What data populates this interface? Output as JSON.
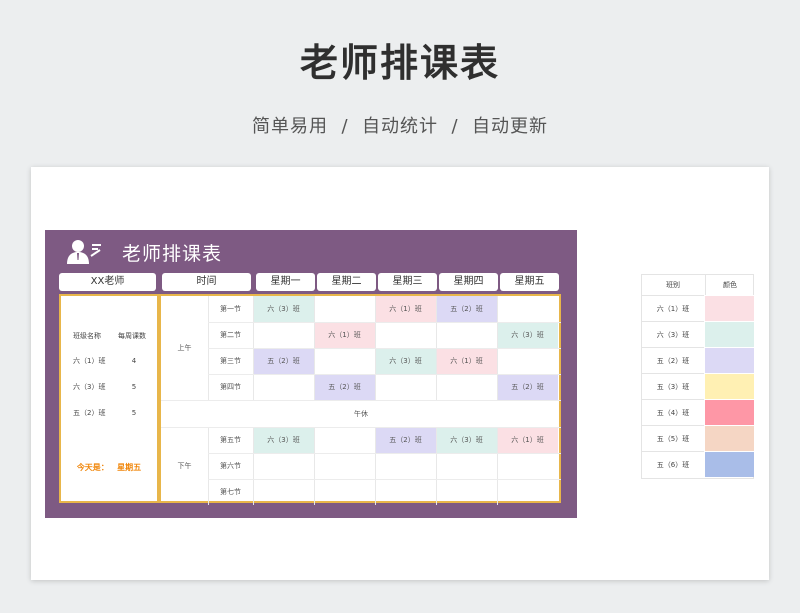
{
  "hero": {
    "title": "老师排课表",
    "subtitle": "简单易用  /  自动统计  /  自动更新"
  },
  "panel": {
    "title": "老师排课表",
    "icon": "teacher-icon",
    "bg_color": "#7e5a83"
  },
  "headers": {
    "teacher": "XX老师",
    "time": "时间",
    "days": [
      "星期一",
      "星期二",
      "星期三",
      "星期四",
      "星期五"
    ]
  },
  "teacher_panel": {
    "col_class": "班级名称",
    "col_count": "每周课数",
    "rows": [
      {
        "class": "六（1）班",
        "count": "4"
      },
      {
        "class": "六（3）班",
        "count": "5"
      },
      {
        "class": "五（2）班",
        "count": "5"
      }
    ],
    "today_label": "今天是：",
    "today_value": "星期五"
  },
  "schedule": {
    "morning_label": "上午",
    "afternoon_label": "下午",
    "lunch_label": "午休",
    "periods": [
      "第一节",
      "第二节",
      "第三节",
      "第四节",
      "第五节",
      "第六节",
      "第七节"
    ],
    "cells": [
      [
        "六（3）班",
        "",
        "六（1）班",
        "五（2）班",
        ""
      ],
      [
        "",
        "六（1）班",
        "",
        "",
        "六（3）班"
      ],
      [
        "五（2）班",
        "",
        "六（3）班",
        "六（1）班",
        ""
      ],
      [
        "",
        "五（2）班",
        "",
        "",
        "五（2）班"
      ],
      [
        "六（3）班",
        "",
        "五（2）班",
        "六（3）班",
        "六（1）班"
      ],
      [
        "",
        "",
        "",
        "",
        ""
      ],
      [
        "",
        "",
        "",
        "",
        ""
      ]
    ]
  },
  "legend": {
    "col_class": "班别",
    "col_color": "颜色",
    "items": [
      {
        "class": "六（1）班",
        "color": "#fbe0e4"
      },
      {
        "class": "六（3）班",
        "color": "#dcf0ec"
      },
      {
        "class": "五（2）班",
        "color": "#dcd9f5"
      },
      {
        "class": "五（3）班",
        "color": "#fff0b3"
      },
      {
        "class": "五（4）班",
        "color": "#fe97a6"
      },
      {
        "class": "五（5）班",
        "color": "#f5d6c4"
      },
      {
        "class": "五（6）班",
        "color": "#a9bde8"
      }
    ]
  }
}
